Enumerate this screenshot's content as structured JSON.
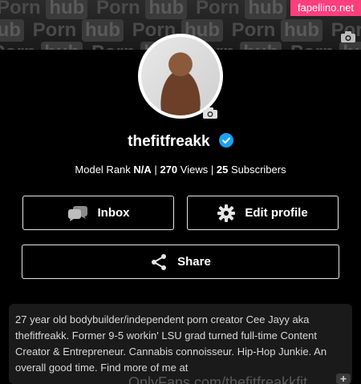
{
  "banner": {
    "rows": [
      "Porn hub Porn hub Porn hub Porn",
      "hub Porn hub Porn hub Porn hub Porn",
      "Porn hub Porn hub Porn hub Porn hub"
    ]
  },
  "watermark": {
    "text": "fapellino.net"
  },
  "profile": {
    "username": "thefitfreakk",
    "verified": true
  },
  "stats": {
    "rank_label": "Model Rank",
    "rank_value": "N/A",
    "views_value": "270",
    "views_label": "Views",
    "subs_value": "25",
    "subs_label": "Subscribers",
    "separator": "|"
  },
  "buttons": {
    "inbox": "Inbox",
    "edit_profile": "Edit profile",
    "share": "Share"
  },
  "bio": {
    "text": "27 year old bodybuilder/independent porn creator Cee Jayy aka thefitfreakk. Former 9-5 workin' LSU grad turned full-time Content Creator & Entrepreneur. Cannabis connoisseur. Hip-Hop Junkie. An overall good time. Find more of me at",
    "overflow_text": "OnlyFans.com/thefitfreakkfit"
  },
  "icons": {
    "camera": "camera-icon",
    "verified": "verified-badge-icon",
    "inbox": "chat-bubbles-icon",
    "edit": "gear-icon",
    "share": "share-icon"
  },
  "colors": {
    "background": "#000000",
    "verified": "#1da1f2",
    "watermark": "#ff3f7d",
    "bio_bg": "#1a1a1a"
  }
}
